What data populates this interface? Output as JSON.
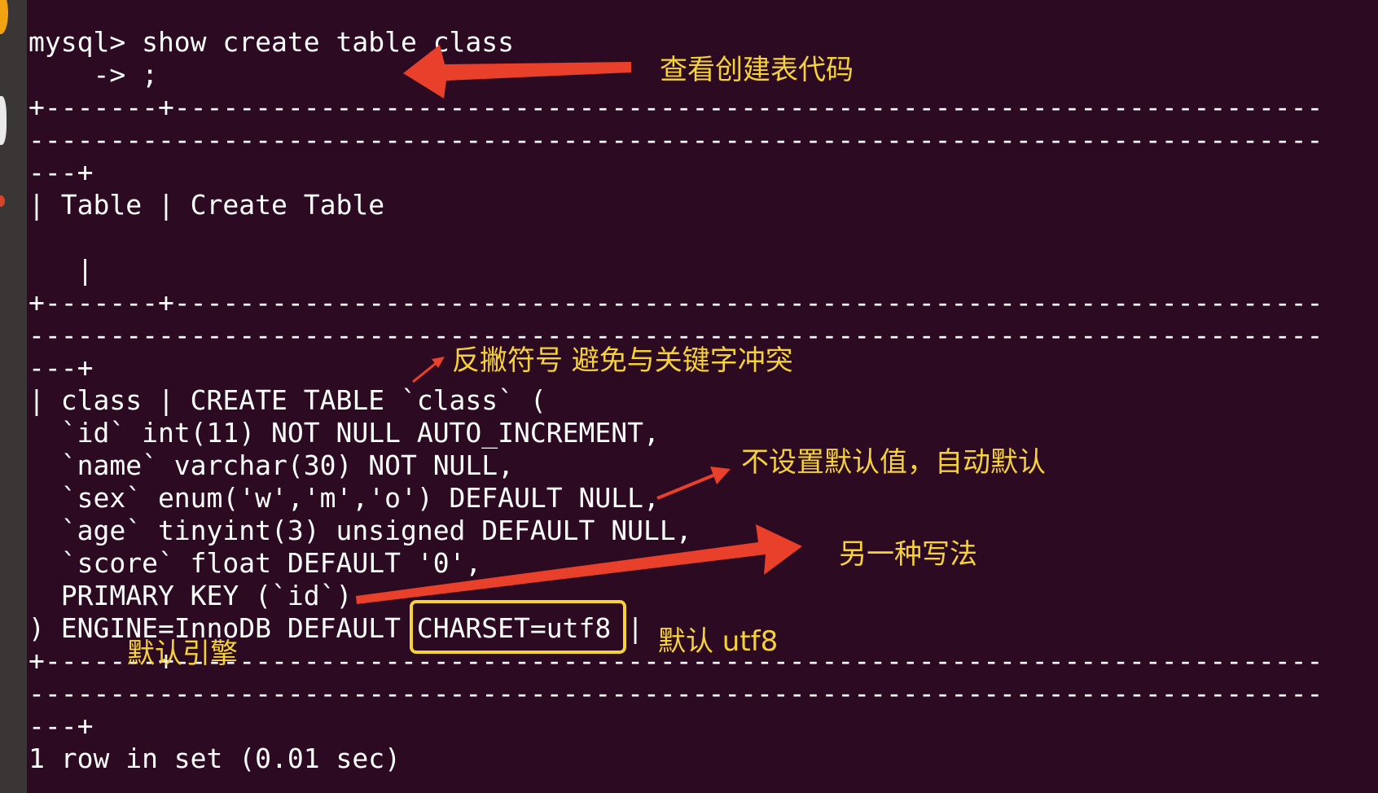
{
  "terminal": {
    "lines": [
      "mysql> show create table class",
      "    -> ;",
      "+-------+-----------------------------------------------------------------------",
      "--------------------------------------------------------------------------------",
      "---+",
      "| Table | Create Table",
      "",
      "   |",
      "+-------+-----------------------------------------------------------------------",
      "--------------------------------------------------------------------------------",
      "---+",
      "| class | CREATE TABLE `class` (",
      "  `id` int(11) NOT NULL AUTO_INCREMENT,",
      "  `name` varchar(30) NOT NULL,",
      "  `sex` enum('w','m','o') DEFAULT NULL,",
      "  `age` tinyint(3) unsigned DEFAULT NULL,",
      "  `score` float DEFAULT '0',",
      "  PRIMARY KEY (`id`)",
      ") ENGINE=InnoDB DEFAULT CHARSET=utf8 |",
      "+-------+-----------------------------------------------------------------------",
      "--------------------------------------------------------------------------------",
      "---+",
      "1 row in set (0.01 sec)"
    ]
  },
  "annotations": {
    "view_create_code": "查看创建表代码",
    "backtick_note": "反撇符号  避免与关键字冲突",
    "default_null_note": "不设置默认值，自动默认",
    "alt_syntax_note": "另一种写法",
    "default_utf8_note": "默认 utf8",
    "default_engine_note": "默认引擎"
  },
  "colors": {
    "background": "#2c0a22",
    "text": "#ffffff",
    "annotation": "#f5d23a",
    "arrow": "#e8402a"
  }
}
